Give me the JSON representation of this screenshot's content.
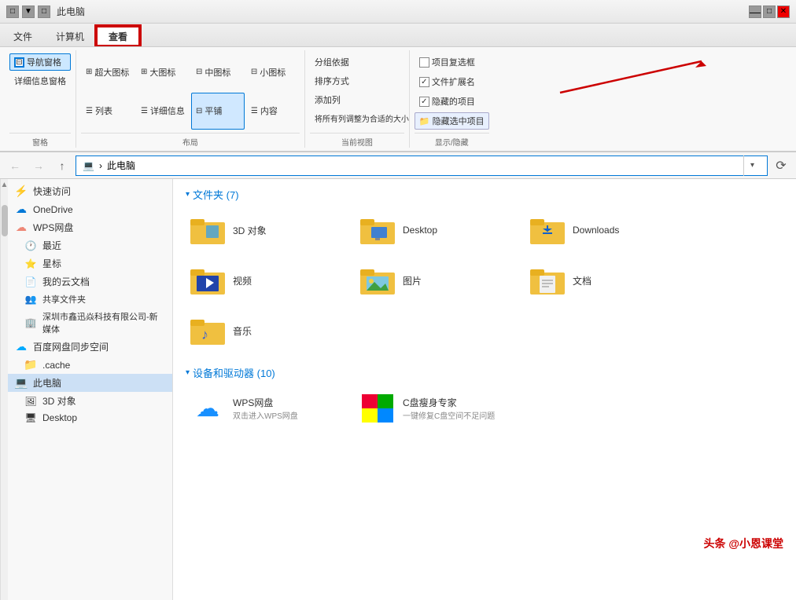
{
  "titleBar": {
    "title": "此电脑",
    "icons": [
      "□",
      "▼",
      "□"
    ]
  },
  "tabs": [
    {
      "id": "file",
      "label": "文件",
      "active": false
    },
    {
      "id": "computer",
      "label": "计算机",
      "active": false
    },
    {
      "id": "view",
      "label": "查看",
      "active": true,
      "highlighted": true
    }
  ],
  "ribbon": {
    "sections": [
      {
        "id": "pane",
        "label": "窗格",
        "rows": [
          [
            {
              "label": "导航窗格",
              "icon": "⊟",
              "active": true
            }
          ],
          [
            {
              "label": "详细信息窗格",
              "icon": "⊞"
            }
          ]
        ]
      },
      {
        "id": "layout",
        "label": "布局",
        "items": [
          {
            "label": "超大图标",
            "icon": "⊞"
          },
          {
            "label": "大图标",
            "icon": "⊞"
          },
          {
            "label": "中图标",
            "icon": "⊞"
          },
          {
            "label": "小图标",
            "icon": "⊟"
          },
          {
            "label": "列表",
            "icon": "☰"
          },
          {
            "label": "详细信息",
            "icon": "☰"
          },
          {
            "label": "平铺",
            "icon": "⊟",
            "active": true
          },
          {
            "label": "内容",
            "icon": "☰"
          }
        ]
      },
      {
        "id": "current-view",
        "label": "当前视图",
        "items": [
          {
            "label": "分组依据"
          },
          {
            "label": "排序方式"
          },
          {
            "label": "添加列"
          },
          {
            "label": "将所有列调整为合适的大小"
          }
        ]
      },
      {
        "id": "show-hide",
        "label": "显示/隐藏",
        "items": [
          {
            "label": "项目复选框",
            "checked": false
          },
          {
            "label": "文件扩展名",
            "checked": true
          },
          {
            "label": "隐藏的项目",
            "checked": true
          },
          {
            "label": "隐藏选中项目"
          }
        ]
      }
    ]
  },
  "addressBar": {
    "back": "←",
    "forward": "→",
    "up": "↑",
    "computerIcon": "💻",
    "path": "此电脑",
    "dropdown": "▾",
    "refresh": "⟳"
  },
  "sidebar": {
    "items": [
      {
        "id": "quick-access",
        "label": "快速访问",
        "icon": "⚡",
        "indent": 0
      },
      {
        "id": "onedrive",
        "label": "OneDrive",
        "icon": "☁",
        "indent": 0
      },
      {
        "id": "wps-cloud",
        "label": "WPS网盘",
        "icon": "☁",
        "indent": 0
      },
      {
        "id": "recent",
        "label": "最近",
        "icon": "🕐",
        "indent": 1
      },
      {
        "id": "starred",
        "label": "星标",
        "icon": "⭐",
        "indent": 1
      },
      {
        "id": "my-docs",
        "label": "我的云文档",
        "icon": "📄",
        "indent": 1
      },
      {
        "id": "shared",
        "label": "共享文件夹",
        "icon": "👥",
        "indent": 1
      },
      {
        "id": "shenzhen",
        "label": "深圳市鑫迅焱科技有限公司-新媒体",
        "icon": "🏢",
        "indent": 1
      },
      {
        "id": "baidu",
        "label": "百度网盘同步空间",
        "icon": "☁",
        "indent": 0
      },
      {
        "id": "cache",
        "label": ".cache",
        "icon": "📁",
        "indent": 1
      },
      {
        "id": "this-pc",
        "label": "此电脑",
        "icon": "💻",
        "indent": 0,
        "selected": true
      },
      {
        "id": "3d-objects",
        "label": "3D 对象",
        "icon": "🖼",
        "indent": 1
      },
      {
        "id": "desktop",
        "label": "Desktop",
        "icon": "🖥",
        "indent": 1
      }
    ]
  },
  "content": {
    "foldersTitle": "文件夹 (7)",
    "folders": [
      {
        "name": "3D 对象",
        "type": "3d"
      },
      {
        "name": "Desktop",
        "type": "desktop"
      },
      {
        "name": "Downloads",
        "type": "downloads"
      },
      {
        "name": "视频",
        "type": "video"
      },
      {
        "name": "图片",
        "type": "pictures"
      },
      {
        "name": "文档",
        "type": "documents"
      },
      {
        "name": "音乐",
        "type": "music"
      }
    ],
    "devicesTitle": "设备和驱动器 (10)",
    "devices": [
      {
        "name": "WPS网盘",
        "desc": "双击进入WPS网盘",
        "icon": "☁"
      },
      {
        "name": "C盘瘦身专家",
        "desc": "一键修复C盘空间不足问题",
        "icon": "🪟"
      }
    ]
  },
  "watermark": "头条 @小恩课堂"
}
